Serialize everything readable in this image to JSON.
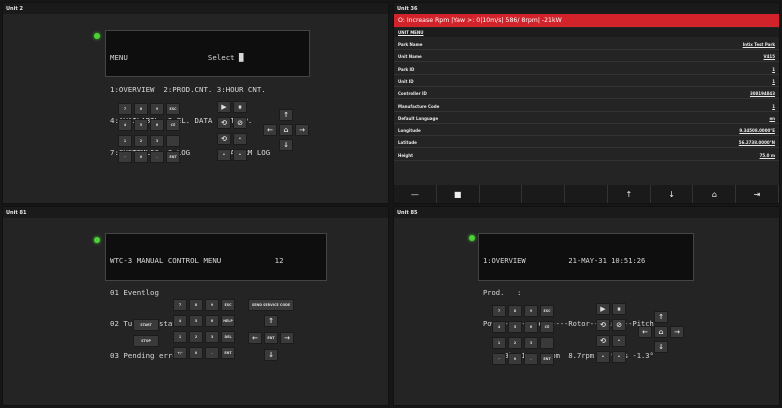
{
  "unit2": {
    "title": "Unit 2",
    "lcd_lines": [
      "MENU                  Select █",
      "1:OVERVIEW  2:PROD.CNT. 3:HOUR CNT.",
      "4:AVAILABIL. 5:EL. DATA  6:TEMP.",
      "7:SYSTEMLOG  8:LOG       9:ALARM LOG"
    ],
    "keypad": [
      "7",
      "8",
      "9",
      "ESC",
      "4",
      "5",
      "6",
      "CE",
      "1",
      "2",
      "3",
      "",
      "-",
      "0",
      ".",
      "ENT"
    ]
  },
  "unit36": {
    "title": "Unit 36",
    "alarm": "O: Increase Rpm |Yaw >: 0|10m/s| 586/ 8rpm| -21kW",
    "menu_header": "UNIT MENU",
    "rows": [
      {
        "label": "Park Name",
        "value": "Intix Test Park"
      },
      {
        "label": "Unit Name",
        "value": "V415"
      },
      {
        "label": "Park ID",
        "value": "1"
      },
      {
        "label": "Unit ID",
        "value": "1"
      },
      {
        "label": "Controller ID",
        "value": "308194843"
      },
      {
        "label": "Manufacture Code",
        "value": "1"
      },
      {
        "label": "Default Language",
        "value": "en"
      },
      {
        "label": "Longitude",
        "value": "9.34508.0000°E"
      },
      {
        "label": "Latitude",
        "value": "56.2738.0000°N"
      },
      {
        "label": "Height",
        "value": "75.0 m"
      }
    ],
    "bottom_buttons": [
      "—",
      "■",
      "",
      "",
      "",
      "↑",
      "↓",
      "⌂",
      "⇥"
    ]
  },
  "unit81": {
    "title": "Unit 81",
    "lcd_lines": [
      "WTC-3 MANUAL CONTROL MENU            12",
      "01 Eventlog",
      "02 Turbine status",
      "03 Pending errors"
    ],
    "keypad": [
      "7",
      "8",
      "9",
      "ESC",
      "4",
      "5",
      "6",
      "HELP",
      "1",
      "2",
      "3",
      "DEL",
      "+/-",
      "0",
      ".",
      "ENT"
    ],
    "start": "START",
    "stop": "STOP",
    "service_code": "SEND SERVICE CODE",
    "ent": "ENT"
  },
  "unit85": {
    "title": "Unit 85",
    "lcd_lines": [
      "1:OVERVIEW          21-MAY-31 10:51:26",
      "Prod.   :",
      "Power-------Gen.----Rotor---Wind---Pitch",
      "  90.3kW 1008.1rpm  8.7rpm  4.9m/s -1.3°"
    ],
    "keypad": [
      "7",
      "8",
      "9",
      "ESC",
      "4",
      "5",
      "6",
      "CE",
      "1",
      "2",
      "3",
      "",
      "-",
      "0",
      ".",
      "ENT"
    ]
  }
}
